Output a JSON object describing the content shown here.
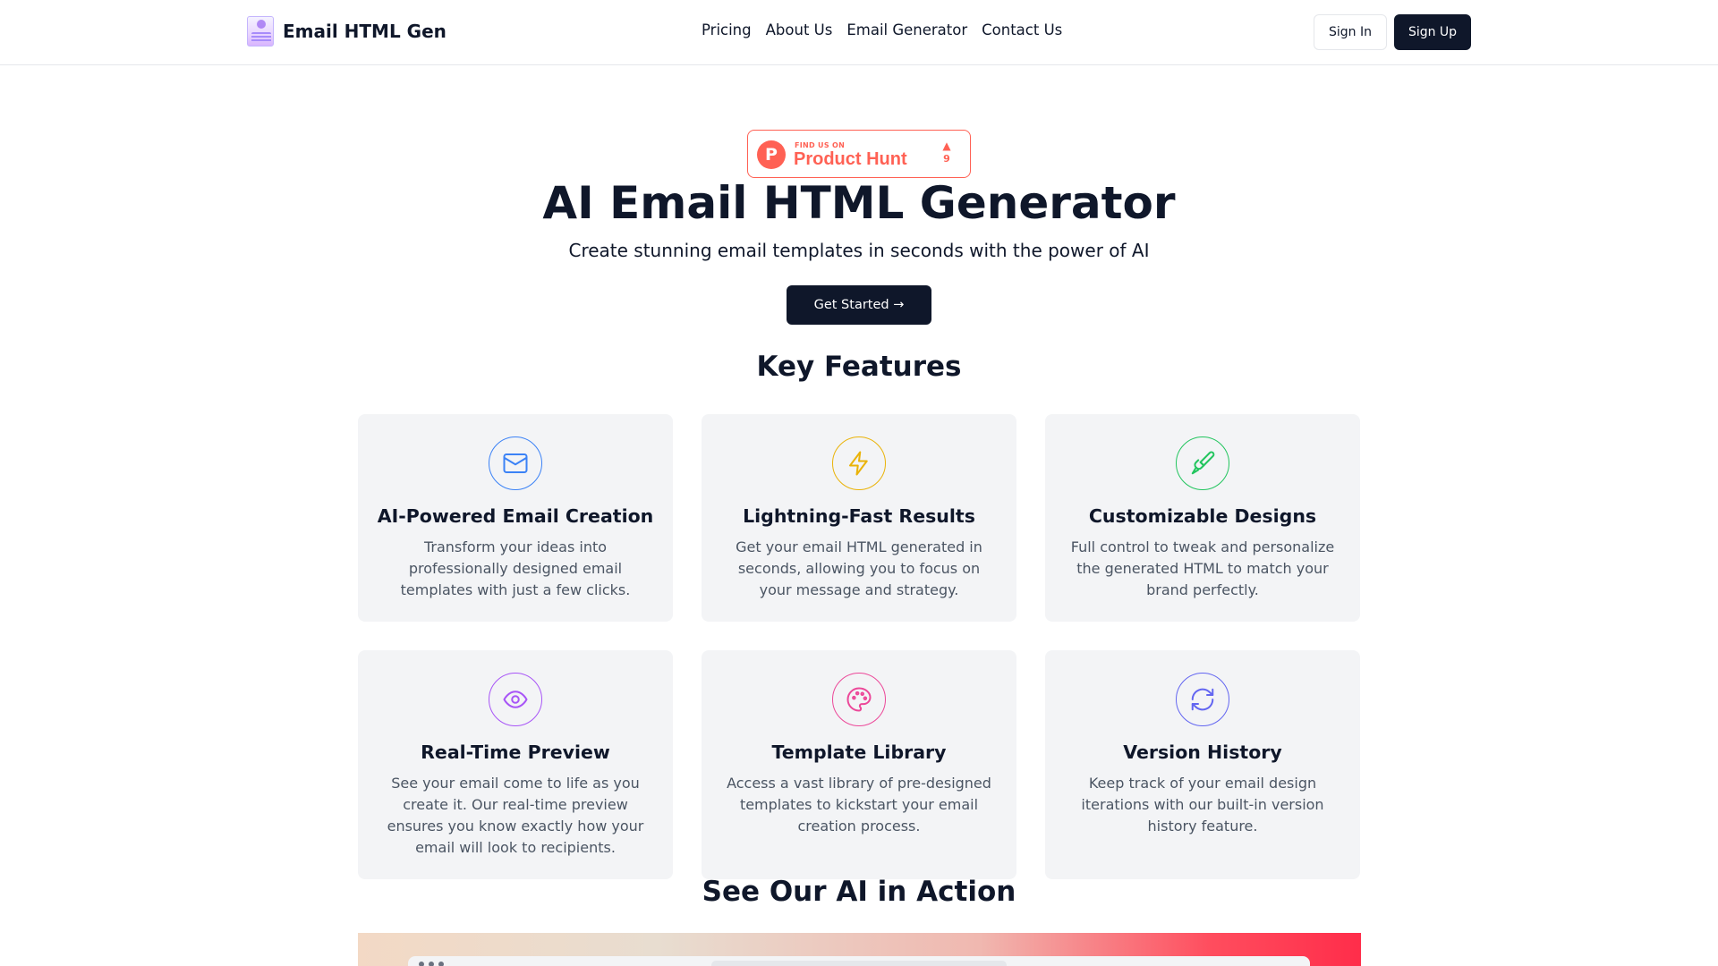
{
  "header": {
    "logo_text": "Email HTML Gen",
    "nav": [
      "Pricing",
      "About Us",
      "Email Generator",
      "Contact Us"
    ],
    "sign_in": "Sign In",
    "sign_up": "Sign Up"
  },
  "product_hunt": {
    "eyebrow": "FIND US ON",
    "name": "Product Hunt",
    "letter": "P",
    "arrow": "▲",
    "votes": "9",
    "color": "#ff6154"
  },
  "hero": {
    "title": "AI Email HTML Generator",
    "subtitle": "Create stunning email templates in seconds with the power of AI",
    "cta": "Get Started →"
  },
  "features": {
    "title": "Key Features",
    "items": [
      {
        "icon": "mail-icon",
        "color": "#3b82f6",
        "title": "AI-Powered Email Creation",
        "text": "Transform your ideas into professionally designed email templates with just a few clicks."
      },
      {
        "icon": "lightning-icon",
        "color": "#eab308",
        "title": "Lightning-Fast Results",
        "text": "Get your email HTML generated in seconds, allowing you to focus on your message and strategy."
      },
      {
        "icon": "paintbrush-icon",
        "color": "#22c55e",
        "title": "Customizable Designs",
        "text": "Full control to tweak and personalize the generated HTML to match your brand perfectly."
      },
      {
        "icon": "eye-icon",
        "color": "#a855f7",
        "title": "Real-Time Preview",
        "text": "See your email come to life as you create it. Our real-time preview ensures you know exactly how your email will look to recipients."
      },
      {
        "icon": "palette-icon",
        "color": "#ec4899",
        "title": "Template Library",
        "text": "Access a vast library of pre-designed templates to kickstart your email creation process."
      },
      {
        "icon": "refresh-icon",
        "color": "#6366f1",
        "title": "Version History",
        "text": "Keep track of your email design iterations with our built-in version history feature."
      }
    ]
  },
  "action": {
    "title": "See Our AI in Action"
  }
}
